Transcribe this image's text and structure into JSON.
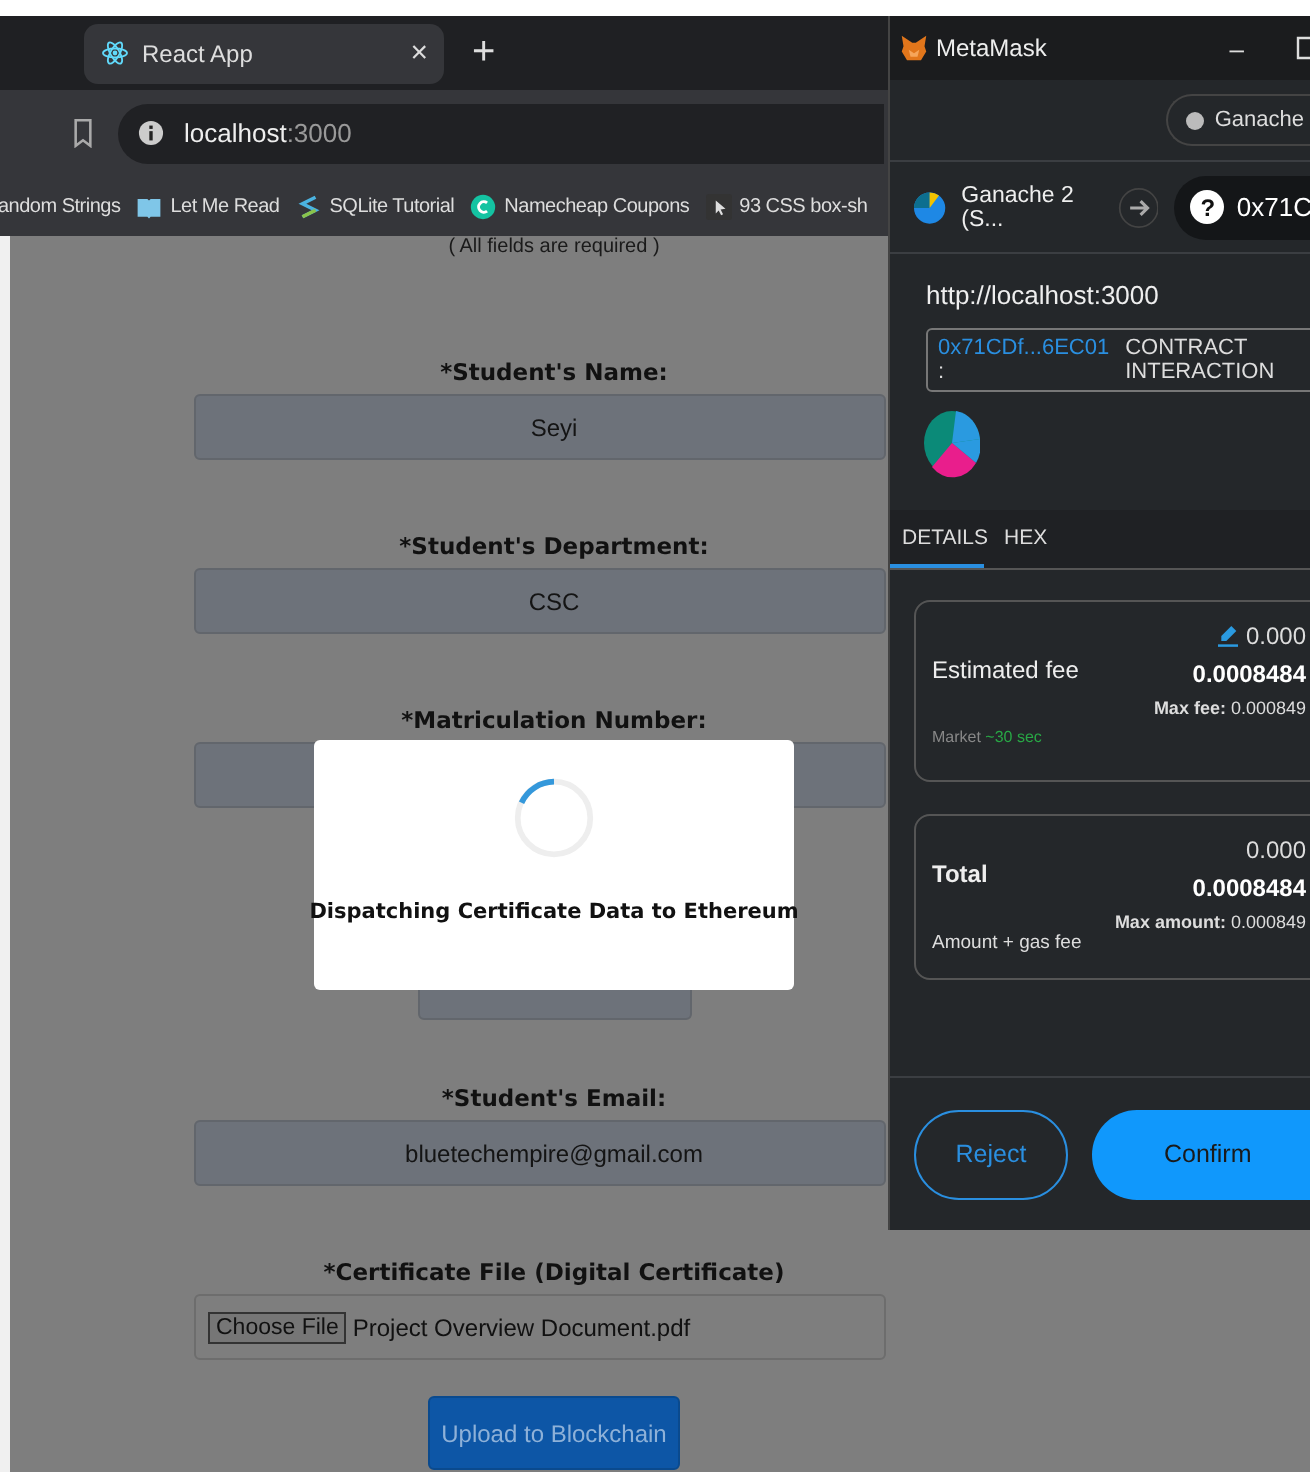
{
  "browser": {
    "tab": {
      "title": "React App",
      "close": "×"
    },
    "new_tab": "+",
    "address": {
      "host": "localhost",
      "port": ":3000"
    },
    "bookmarks": [
      {
        "kind": "none",
        "label": "andom Strings"
      },
      {
        "kind": "book",
        "label": "Let Me Read"
      },
      {
        "kind": "sqlite",
        "label": "SQLite Tutorial"
      },
      {
        "kind": "circle",
        "label": "Namecheap Coupons"
      },
      {
        "kind": "cursor",
        "label": "93 CSS box-sh"
      }
    ]
  },
  "form": {
    "note": "( All fields are required )",
    "fields": [
      {
        "kind": "text",
        "label": "*Student's Name:",
        "value": "Seyi"
      },
      {
        "kind": "text",
        "label": "*Student's Department:",
        "value": "CSC"
      },
      {
        "kind": "text",
        "label": "*Matriculation Number:"
      },
      {
        "kind": "short"
      },
      {
        "kind": "text",
        "label": "*Student's Email:",
        "value": "bluetechempire@gmail.com"
      },
      {
        "kind": "file",
        "label": "*Certificate File (Digital Certificate)",
        "button": "Choose File",
        "value": "Project Overview Document.pdf"
      }
    ],
    "submit": "Upload to Blockchain"
  },
  "modal": {
    "message": "Dispatching Certificate Data to Ethereum"
  },
  "metamask": {
    "title": "MetaMask",
    "minimize": "–",
    "network": "Ganache",
    "from": "Ganache 2 (S...",
    "to_icon": "?",
    "to": "0x71C",
    "origin": "http://localhost:3000",
    "contract_address": "0x71CDf...6EC01",
    "contract_colon": ":",
    "contract_label": "CONTRACT INTERACTION",
    "tabs": [
      {
        "label": "DETAILS",
        "selected": true
      },
      {
        "label": "HEX",
        "selected": false
      }
    ],
    "fee": {
      "label": "Estimated fee",
      "value": "0.000",
      "bold": "0.0008484",
      "speed": "Market",
      "time": "~30 sec",
      "max_label": "Max fee:",
      "max": "0.000849"
    },
    "total": {
      "label": "Total",
      "value": "0.000",
      "bold": "0.0008484",
      "sub": "Amount + gas fee",
      "max_label": "Max amount:",
      "max": "0.000849"
    },
    "reject": "Reject",
    "confirm": "Confirm"
  }
}
